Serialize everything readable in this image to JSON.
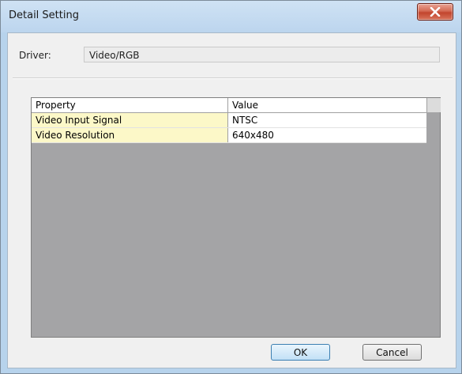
{
  "window": {
    "title": "Detail Setting"
  },
  "driver": {
    "label": "Driver:",
    "value": "Video/RGB"
  },
  "grid": {
    "columns": [
      "Property",
      "Value"
    ],
    "rows": [
      {
        "property": "Video Input Signal",
        "value": "NTSC"
      },
      {
        "property": "Video Resolution",
        "value": "640x480"
      }
    ]
  },
  "buttons": {
    "ok": "OK",
    "cancel": "Cancel"
  },
  "icons": {
    "close": "close-icon"
  },
  "colors": {
    "title_bar": "#bcd5ee",
    "close_button": "#c2452d",
    "property_cell": "#fcf8c8",
    "grid_empty_area": "#a4a4a6"
  }
}
